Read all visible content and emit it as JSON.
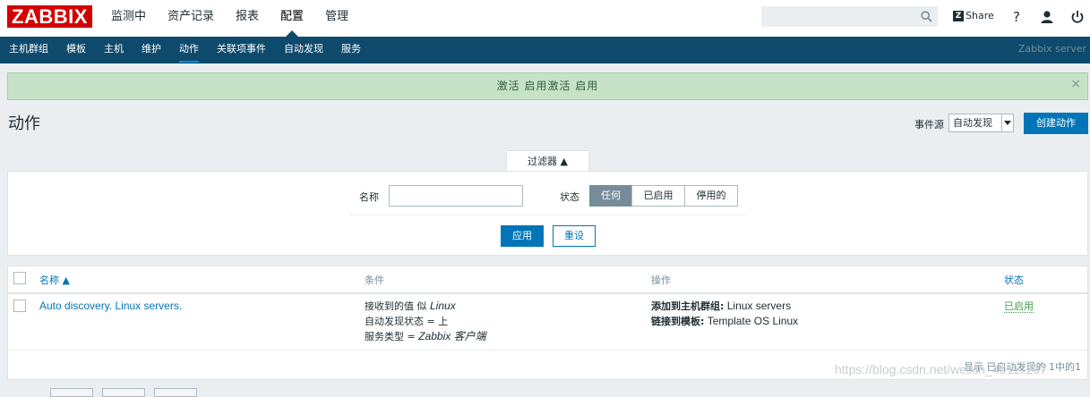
{
  "logo": "ZABBIX",
  "main_nav": [
    "监测中",
    "资产记录",
    "报表",
    "配置",
    "管理"
  ],
  "main_nav_active": "配置",
  "search": {
    "value": "",
    "placeholder": ""
  },
  "share_label": "Share",
  "sub_nav": [
    "主机群组",
    "模板",
    "主机",
    "维护",
    "动作",
    "关联项事件",
    "自动发现",
    "服务"
  ],
  "sub_nav_active": "动作",
  "server_name": "Zabbix server",
  "message": "激活 启用激活 启用",
  "page_title": "动作",
  "event_source": {
    "label": "事件源",
    "selected": "自动发现"
  },
  "create_button": "创建动作",
  "filter": {
    "tab_label": "过滤器 ▲",
    "name_label": "名称",
    "name_value": "",
    "status_label": "状态",
    "status_options": [
      "任何",
      "已启用",
      "停用的"
    ],
    "status_selected": "任何",
    "apply_label": "应用",
    "reset_label": "重设"
  },
  "table": {
    "headers": {
      "name": "名称 ▲",
      "conditions": "条件",
      "operations": "操作",
      "status": "状态"
    },
    "rows": [
      {
        "name": "Auto discovery. Linux servers.",
        "conditions": [
          {
            "prefix": "接收到的值 似 ",
            "value": "Linux"
          },
          {
            "prefix": "自动发现状态 = 上",
            "value": ""
          },
          {
            "prefix": "服务类型 = ",
            "value": "Zabbix 客户端"
          }
        ],
        "operations": [
          {
            "label": "添加到主机群组:",
            "value": " Linux servers"
          },
          {
            "label": "链接到模板:",
            "value": " Template OS Linux"
          }
        ],
        "status": "已启用"
      }
    ],
    "footer": "显示 已自动发现的 1中的1"
  },
  "watermark": "https://blog.csdn.net/weixin_40117297",
  "colors": {
    "brand": "#d40000",
    "nav_bg": "#0e4a6b",
    "primary": "#0275b8",
    "success_bg": "#c6e3c8",
    "enabled": "#429e47"
  }
}
